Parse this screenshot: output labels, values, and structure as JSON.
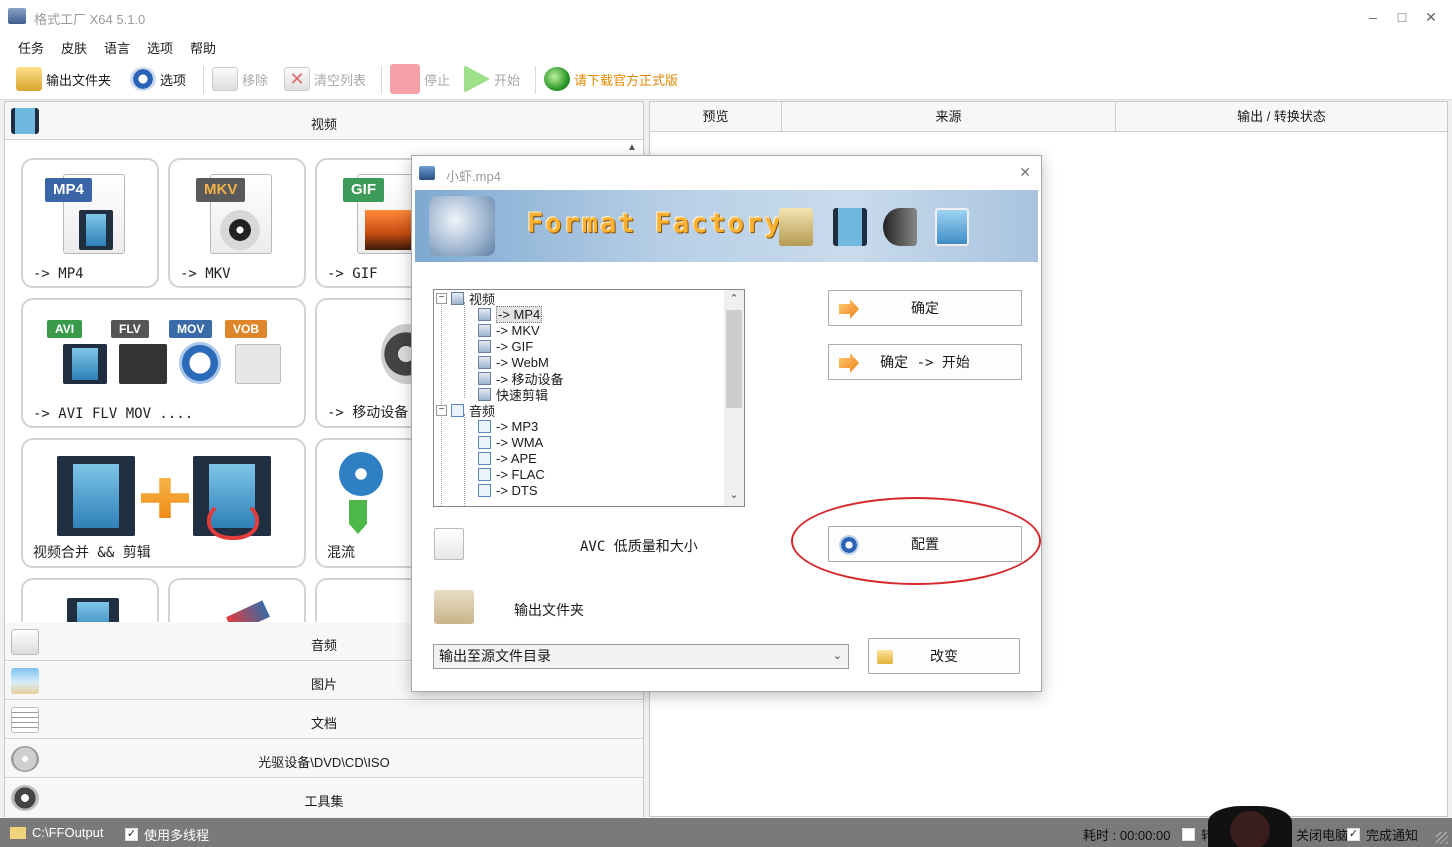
{
  "window": {
    "title": "格式工厂 X64 5.1.0",
    "minimize": "–",
    "maximize": "□",
    "close": "✕"
  },
  "menu": [
    "任务",
    "皮肤",
    "语言",
    "选项",
    "帮助"
  ],
  "toolbar": {
    "output_folder": "输出文件夹",
    "options": "选项",
    "remove": "移除",
    "clear_list": "清空列表",
    "stop": "停止",
    "start": "开始",
    "download": "请下载官方正式版"
  },
  "categories": {
    "video": "视频",
    "audio": "音频",
    "image": "图片",
    "document": "文档",
    "disc": "光驱设备\\DVD\\CD\\ISO",
    "tools": "工具集"
  },
  "tiles": [
    {
      "label": "-> MP4",
      "badge": "MP4"
    },
    {
      "label": "-> MKV",
      "badge": "MKV"
    },
    {
      "label": "-> GIF",
      "badge": "GIF"
    },
    {
      "label": "-> AVI FLV MOV ....",
      "badges": [
        "AVI",
        "FLV",
        "MOV",
        "VOB"
      ]
    },
    {
      "label": "-> 移动设备"
    },
    {
      "label": "视频合并 && 剪辑"
    },
    {
      "label": "混流"
    }
  ],
  "task_columns": [
    "预览",
    "来源",
    "输出 / 转换状态"
  ],
  "dialog": {
    "title": "小虾.mp4",
    "banner_text": "Format Factory",
    "tree": [
      {
        "label": "视频",
        "level": 0,
        "type": "group"
      },
      {
        "label": "-> MP4",
        "level": 1,
        "type": "video",
        "selected": true
      },
      {
        "label": "-> MKV",
        "level": 1,
        "type": "video"
      },
      {
        "label": "-> GIF",
        "level": 1,
        "type": "video"
      },
      {
        "label": "-> WebM",
        "level": 1,
        "type": "video"
      },
      {
        "label": "-> 移动设备",
        "level": 1,
        "type": "video"
      },
      {
        "label": "快速剪辑",
        "level": 1,
        "type": "video"
      },
      {
        "label": "音频",
        "level": 0,
        "type": "group"
      },
      {
        "label": "-> MP3",
        "level": 1,
        "type": "audio"
      },
      {
        "label": "-> WMA",
        "level": 1,
        "type": "audio"
      },
      {
        "label": "-> APE",
        "level": 1,
        "type": "audio"
      },
      {
        "label": "-> FLAC",
        "level": 1,
        "type": "audio"
      },
      {
        "label": "-> DTS",
        "level": 1,
        "type": "audio"
      }
    ],
    "ok_button": "确定",
    "ok_start_button": "确定 -> 开始",
    "profile": "AVC 低质量和大小",
    "config_button": "配置",
    "output_folder_label": "输出文件夹",
    "output_target": "输出至源文件目录",
    "change_button": "改变"
  },
  "status": {
    "output_path": "C:\\FFOutput",
    "multithread": "使用多线程",
    "elapsed": "耗时 : 00:00:00",
    "after_prefix": "转",
    "shutdown": "关闭电脑",
    "notify": "完成通知"
  }
}
